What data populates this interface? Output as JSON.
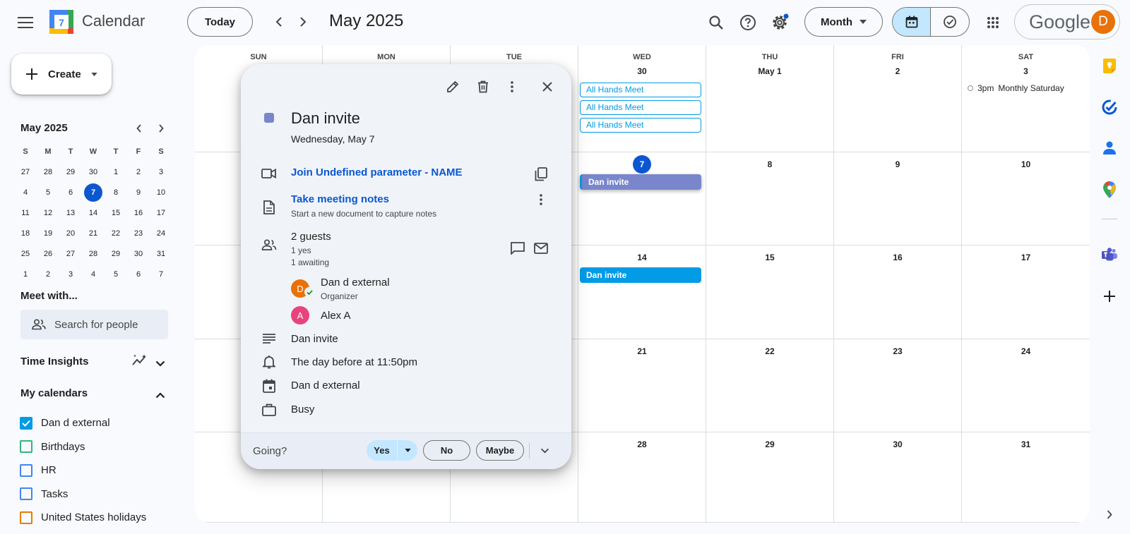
{
  "header": {
    "app_title": "Calendar",
    "logo_day": "7",
    "today_label": "Today",
    "current_period": "May 2025",
    "view_label": "Month",
    "brand": "Google",
    "avatar_initial": "D"
  },
  "sidebar": {
    "create_label": "Create",
    "mini_calendar": {
      "title": "May 2025",
      "dow": [
        "S",
        "M",
        "T",
        "W",
        "T",
        "F",
        "S"
      ],
      "weeks": [
        [
          "27",
          "28",
          "29",
          "30",
          "1",
          "2",
          "3"
        ],
        [
          "4",
          "5",
          "6",
          "7",
          "8",
          "9",
          "10"
        ],
        [
          "11",
          "12",
          "13",
          "14",
          "15",
          "16",
          "17"
        ],
        [
          "18",
          "19",
          "20",
          "21",
          "22",
          "23",
          "24"
        ],
        [
          "25",
          "26",
          "27",
          "28",
          "29",
          "30",
          "31"
        ],
        [
          "1",
          "2",
          "3",
          "4",
          "5",
          "6",
          "7"
        ]
      ],
      "selected": "7"
    },
    "meet_title": "Meet with...",
    "search_placeholder": "Search for people",
    "time_insights": "Time Insights",
    "my_calendars_title": "My calendars",
    "calendars": [
      {
        "label": "Dan d external",
        "checked": true,
        "color": "#039be5"
      },
      {
        "label": "Birthdays",
        "checked": false,
        "color": "#33b679"
      },
      {
        "label": "HR",
        "checked": false,
        "color": "#4285f4"
      },
      {
        "label": "Tasks",
        "checked": false,
        "color": "#4285f4"
      },
      {
        "label": "United States holidays",
        "checked": false,
        "color": "#e67c00"
      }
    ]
  },
  "grid": {
    "dow": [
      "SUN",
      "MON",
      "TUE",
      "WED",
      "THU",
      "FRI",
      "SAT"
    ],
    "weeks": [
      [
        "",
        "",
        "",
        "30",
        "May 1",
        "2",
        "3"
      ],
      [
        "",
        "",
        "",
        "7",
        "8",
        "9",
        "10"
      ],
      [
        "",
        "",
        "",
        "14",
        "15",
        "16",
        "17"
      ],
      [
        "",
        "",
        "",
        "21",
        "22",
        "23",
        "24"
      ],
      [
        "",
        "",
        "",
        "28",
        "29",
        "30",
        "31"
      ]
    ],
    "today": "7",
    "events": {
      "all_hands": [
        "All Hands Meet",
        "All Hands Meet",
        "All Hands Meet"
      ],
      "monthly_time": "3pm",
      "monthly_title": "Monthly Saturday",
      "dan_invite_1": "Dan invite",
      "dan_invite_2": "Dan invite"
    },
    "colors": {
      "outline": "#039be5",
      "lavender": "#7986cb",
      "peacock": "#039be5"
    }
  },
  "popup": {
    "title": "Dan invite",
    "date": "Wednesday, May 7",
    "join_label": "Join Undefined parameter - NAME",
    "notes_label": "Take meeting notes",
    "notes_sub": "Start a new document to capture notes",
    "guests_count": "2 guests",
    "guests_yes": "1 yes",
    "guests_awaiting": "1 awaiting",
    "guests": [
      {
        "initial": "D",
        "name": "Dan d external",
        "role": "Organizer",
        "color": "#e8710a"
      },
      {
        "initial": "A",
        "name": "Alex A",
        "role": "",
        "color": "#e8437b"
      }
    ],
    "description": "Dan invite",
    "reminder": "The day before at 11:50pm",
    "calendar": "Dan d external",
    "availability": "Busy",
    "going_label": "Going?",
    "yes_label": "Yes",
    "no_label": "No",
    "maybe_label": "Maybe"
  }
}
